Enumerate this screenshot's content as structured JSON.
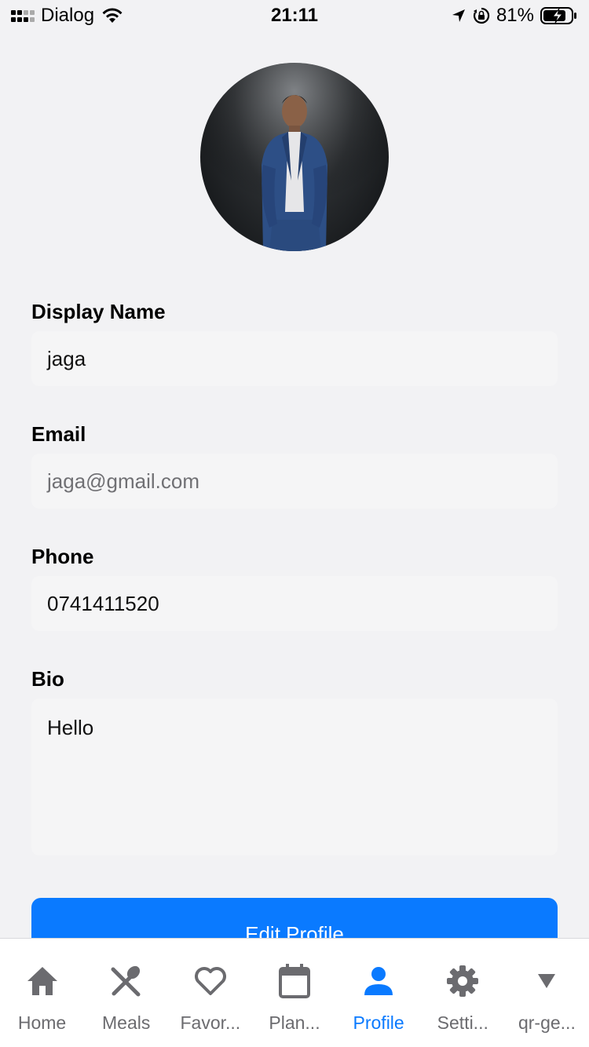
{
  "status_bar": {
    "carrier": "Dialog",
    "time": "21:11",
    "battery": "81%"
  },
  "form": {
    "display_name_label": "Display Name",
    "display_name_value": "jaga",
    "email_label": "Email",
    "email_placeholder": "jaga@gmail.com",
    "phone_label": "Phone",
    "phone_value": "0741411520",
    "bio_label": "Bio",
    "bio_value": "Hello"
  },
  "edit_button_label": "Edit Profile",
  "tabs": [
    {
      "label": "Home",
      "icon": "home-icon"
    },
    {
      "label": "Meals",
      "icon": "utensils-icon"
    },
    {
      "label": "Favor...",
      "icon": "heart-icon"
    },
    {
      "label": "Plan...",
      "icon": "calendar-icon"
    },
    {
      "label": "Profile",
      "icon": "person-icon"
    },
    {
      "label": "Setti...",
      "icon": "gear-icon"
    },
    {
      "label": "qr-ge...",
      "icon": "triangle-down-icon"
    }
  ],
  "colors": {
    "accent": "#0a7aff",
    "inactive_tab": "#6b6b6f",
    "background": "#f2f2f4"
  }
}
